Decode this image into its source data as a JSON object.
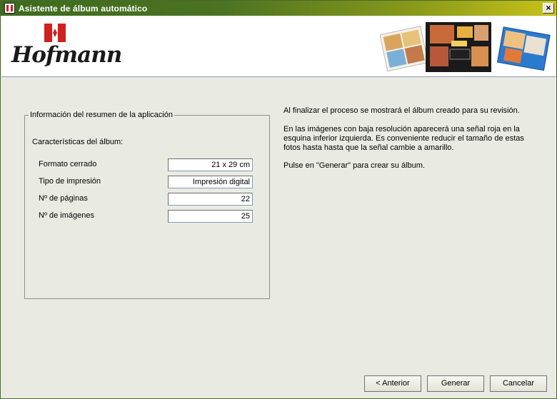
{
  "window": {
    "title": "Asistente de álbum automático",
    "close_glyph": "×"
  },
  "brand": {
    "name": "Hofmann",
    "flag_color": "#d02020"
  },
  "summary": {
    "legend": "Información del resumen de la aplicación",
    "features_label": "Características del álbum:",
    "rows": [
      {
        "label": "Formato cerrado",
        "value": "21 x 29 cm"
      },
      {
        "label": "Tipo de impresión",
        "value": "Impresión digital"
      },
      {
        "label": "Nº de páginas",
        "value": "22"
      },
      {
        "label": "Nº de imágenes",
        "value": "25"
      }
    ]
  },
  "info": {
    "paragraph1": "Al finalizar el proceso se mostrará el álbum creado para su revisión.",
    "paragraph2": "En las imágenes con baja resolución aparecerá una señal roja en la esquina inferior izquierda. Es conveniente reducir el tamaño de estas fotos hasta hasta que la señal cambie a amarillo.",
    "paragraph3": "Pulse en \"Generar\" para crear su álbum."
  },
  "buttons": {
    "back": "< Anterior",
    "generate": "Generar",
    "cancel": "Cancelar"
  }
}
